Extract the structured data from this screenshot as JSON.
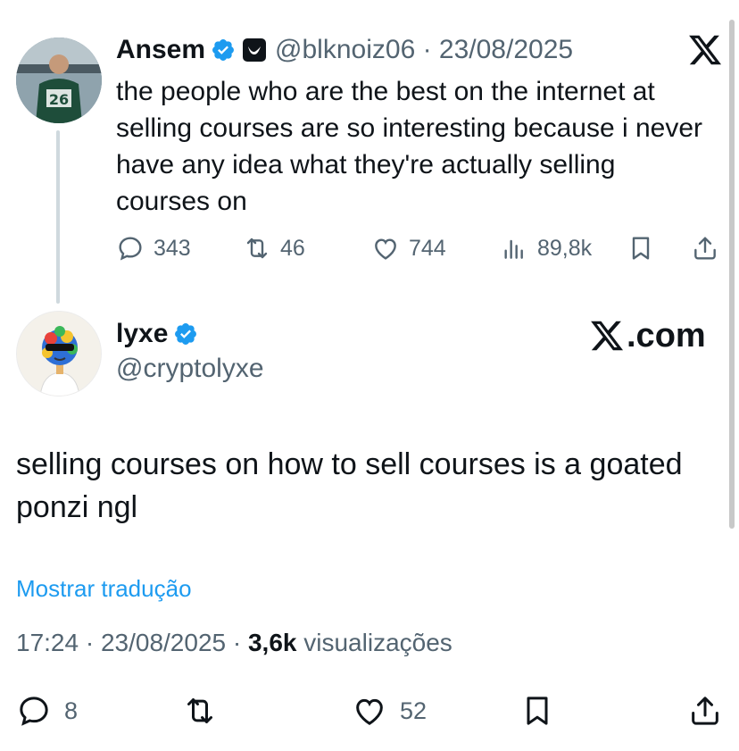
{
  "quoted_tweet": {
    "author_name": "Ansem",
    "handle_and_date": "@blknoiz06 · 23/08/2025",
    "text": "the people who are the best on the internet at selling courses are so interesting because i never have any idea what they're actually selling courses on",
    "actions": {
      "replies": "343",
      "reposts": "46",
      "likes": "744",
      "views": "89,8k"
    },
    "icons": [
      "verified-badge-icon",
      "affiliate-badge-icon",
      "x-logo-icon",
      "reply-icon",
      "repost-icon",
      "like-icon",
      "views-icon",
      "bookmark-icon",
      "share-icon"
    ]
  },
  "main_tweet": {
    "author_name": "lyxe",
    "handle": "@cryptolyxe",
    "watermark": ".com",
    "text": "selling courses on how to sell courses is a goated ponzi ngl",
    "translate_link": "Mostrar tradução",
    "time_date": "17:24 · 23/08/2025 · ",
    "views_count": "3,6k",
    "views_label": " visualizações",
    "actions": {
      "replies": "8",
      "likes": "52"
    }
  },
  "colors": {
    "text": "#0f1419",
    "secondary": "#536471",
    "accent": "#1d9bf0",
    "thread_line": "#cfd9de"
  }
}
